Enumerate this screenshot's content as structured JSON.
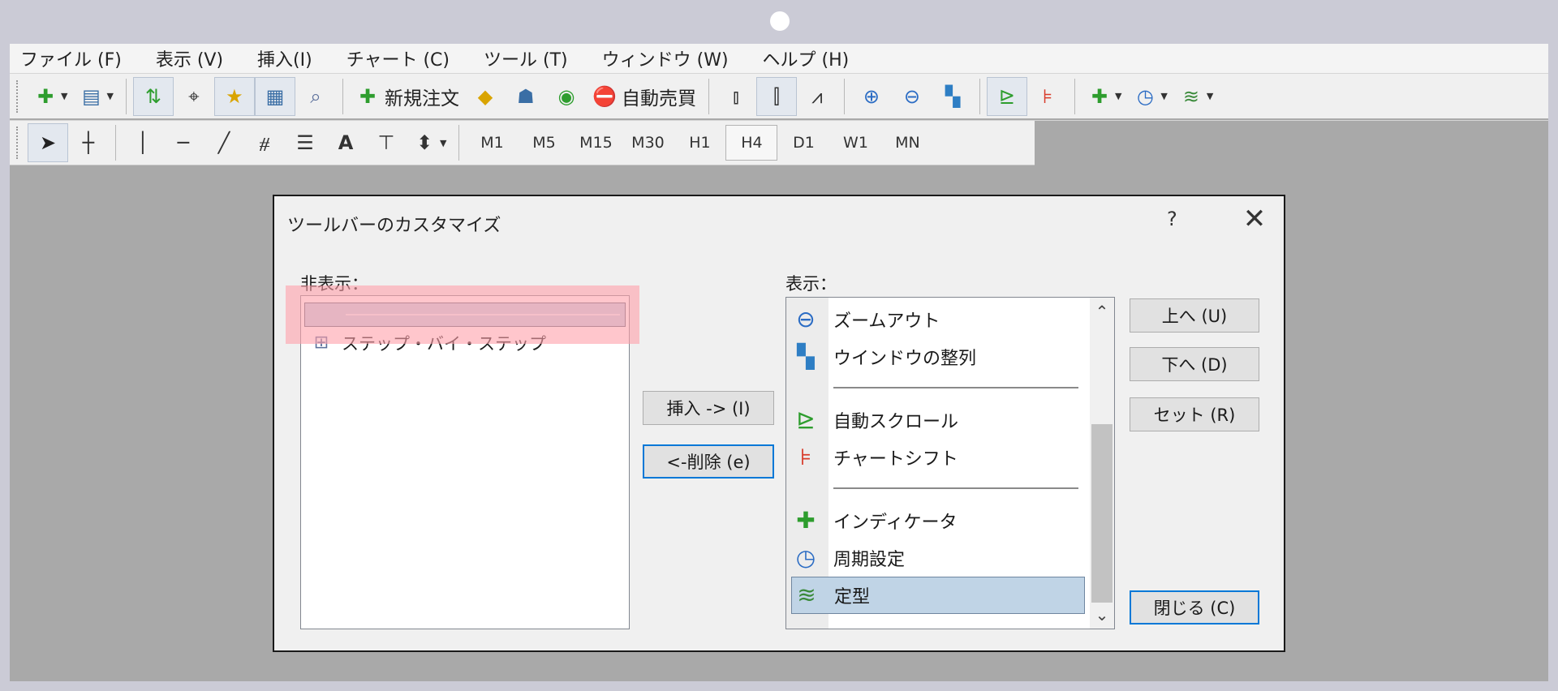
{
  "menubar": {
    "items": [
      "ファイル (F)",
      "表示 (V)",
      "挿入(I)",
      "チャート (C)",
      "ツール (T)",
      "ウィンドウ (W)",
      "ヘルプ (H)"
    ]
  },
  "toolbar1": {
    "new_order_label": "新規注文",
    "auto_trade_label": "自動売買"
  },
  "toolbar2": {
    "timeframes": [
      "M1",
      "M5",
      "M15",
      "M30",
      "H1",
      "H4",
      "D1",
      "W1",
      "MN"
    ],
    "active_timeframe": "H4"
  },
  "dialog": {
    "title": "ツールバーのカスタマイズ",
    "help": "?",
    "close": "✕",
    "hidden_label": "非表示：",
    "shown_label": "表示：",
    "hidden_items": [
      "ステップ・バイ・ステップ"
    ],
    "shown_items": {
      "zoom_out": "ズームアウト",
      "tile_windows": "ウインドウの整列",
      "auto_scroll": "自動スクロール",
      "chart_shift": "チャートシフト",
      "indicators": "インディケータ",
      "periodicity": "周期設定",
      "template": "定型"
    },
    "buttons": {
      "insert": "挿入 -> (I)",
      "remove": "<-削除 (e)",
      "up": "上へ (U)",
      "down": "下へ (D)",
      "reset": "セット (R)",
      "close": "閉じる (C)"
    }
  },
  "colors": {
    "highlight": "#c0d4e6",
    "focus": "#0078d7",
    "pink_overlay": "#ffa0aa"
  }
}
